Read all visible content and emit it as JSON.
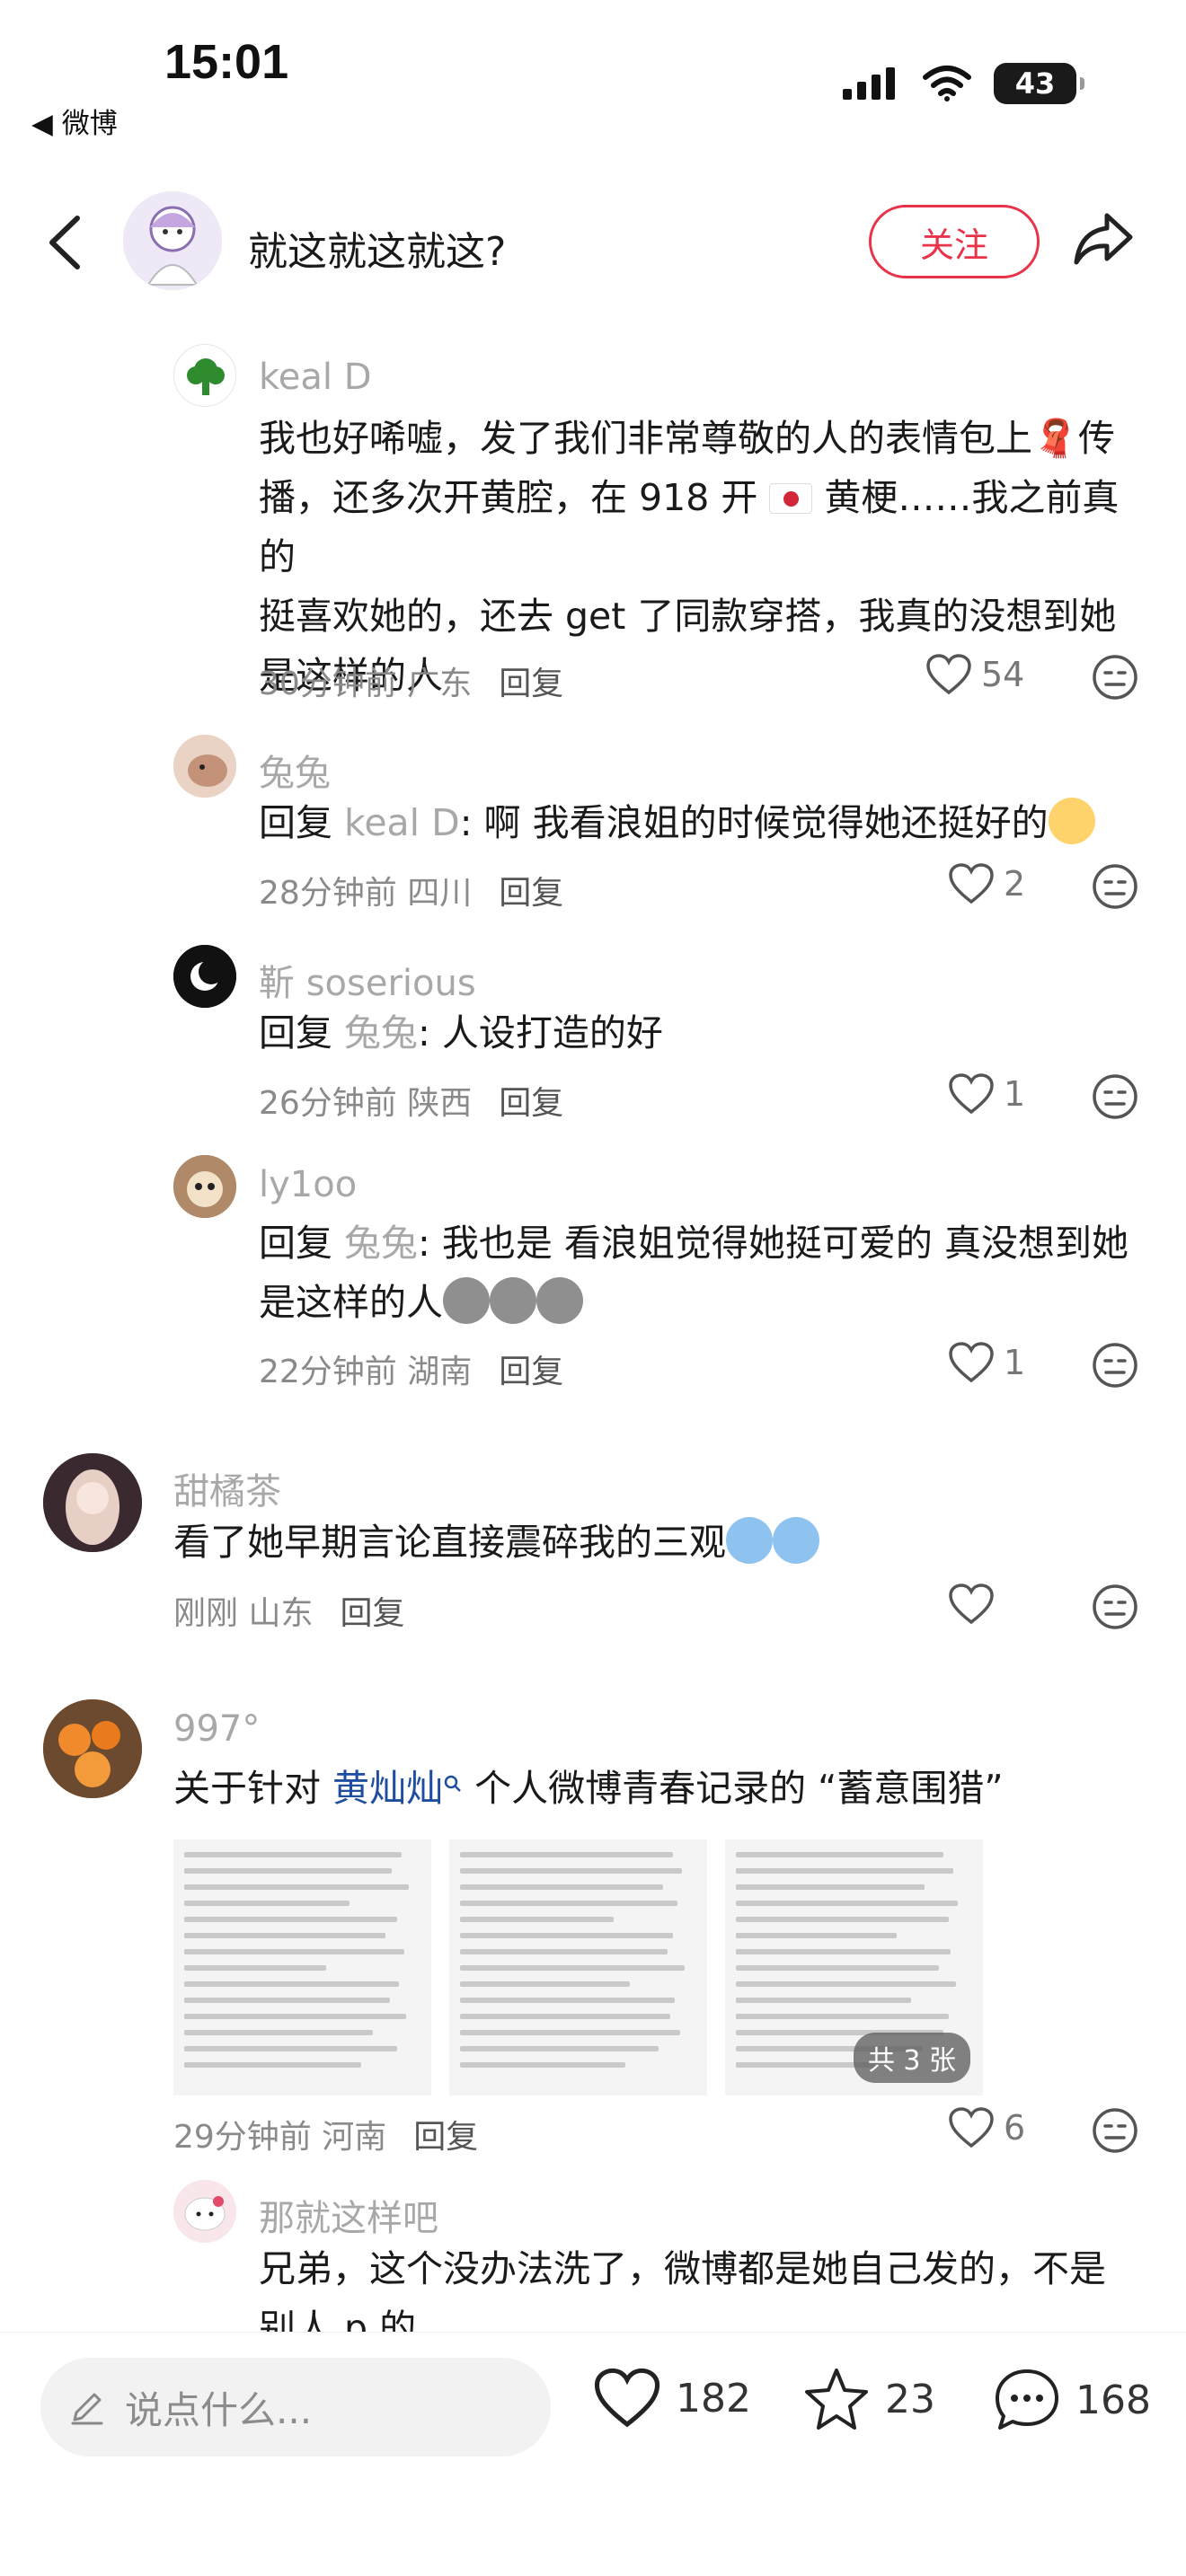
{
  "status": {
    "time": "15:01",
    "back_app": "◀ 微博",
    "battery": "43"
  },
  "header": {
    "title": "就这就这就这?",
    "follow_label": "关注"
  },
  "comments": [
    {
      "user": "keal D",
      "text_lines": [
        "我也好唏嘘，发了我们非常尊敬的人的表情包上🧣传",
        "播，还多次开黄腔，在 918 开",
        "黄梗……我之前真的",
        "挺喜欢她的，还去 get 了同款穿搭，我真的没想到她",
        "是这样的人"
      ],
      "time": "30分钟前",
      "location": "广东",
      "reply_label": "回复",
      "likes": "54"
    },
    {
      "user": "兔兔",
      "reply_prefix": "回复",
      "reply_to": "keal D",
      "text": ": 啊 我看浪姐的时候觉得她还挺好的",
      "time": "28分钟前",
      "location": "四川",
      "reply_label": "回复",
      "likes": "2"
    },
    {
      "user": "靳 soserious",
      "reply_prefix": "回复",
      "reply_to": "兔兔",
      "text": ": 人设打造的好",
      "time": "26分钟前",
      "location": "陕西",
      "reply_label": "回复",
      "likes": "1"
    },
    {
      "user": "ly1oo",
      "reply_prefix": "回复",
      "reply_to": "兔兔",
      "text_lines": [
        ": 我也是 看浪姐觉得她挺可爱的 真没想到她",
        "是这样的人"
      ],
      "time": "22分钟前",
      "location": "湖南",
      "reply_label": "回复",
      "likes": "1"
    },
    {
      "user": "甜橘茶",
      "text": "看了她早期言论直接震碎我的三观",
      "time": "刚刚",
      "location": "山东",
      "reply_label": "回复",
      "likes": ""
    },
    {
      "user": "997°",
      "text_pre": "关于针对 ",
      "link": "黄灿灿",
      "text_post": " 个人微博青春记录的 “蓄意围猎”",
      "image_count": "共 3 张",
      "time": "29分钟前",
      "location": "河南",
      "reply_label": "回复",
      "likes": "6"
    },
    {
      "user": "那就这样吧",
      "text_lines": [
        "兄弟，这个没办法洗了，微博都是她自己发的，不是",
        "别人 p 的"
      ]
    }
  ],
  "bottom": {
    "placeholder": "说点什么...",
    "likes": "182",
    "favorites": "23",
    "comments": "168"
  },
  "colors": {
    "accent": "#e8334a",
    "link": "#1f4ea0",
    "muted": "#a8a8a8"
  }
}
